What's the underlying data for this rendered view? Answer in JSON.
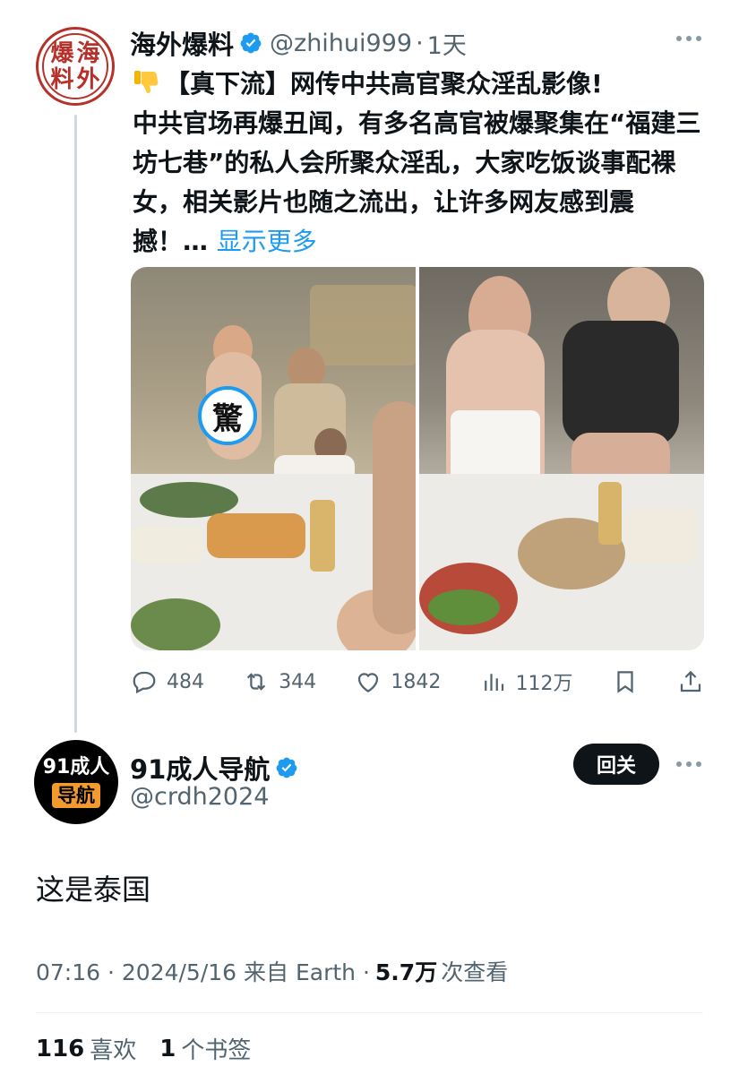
{
  "post1": {
    "avatar_chars": [
      "爆",
      "海",
      "料",
      "外"
    ],
    "name": "海外爆料",
    "handle": "@zhihui999",
    "separator": "·",
    "time": "1天",
    "line1": "【真下流】网传中共高官聚众淫乱影像!",
    "body": "中共官场再爆丑闻，有多名高官被爆聚集在“福建三坊七巷”的私人会所聚众淫乱，大家吃饭谈事配裸女，相关影片也随之流出，让许多网友感到震撼！…",
    "show_more": "显示更多",
    "censor_char": "驚",
    "actions": {
      "replies": "484",
      "reposts": "344",
      "likes": "1842",
      "views": "112万"
    }
  },
  "post2": {
    "avatar_top": "91成人",
    "avatar_bottom": "导航",
    "name": "91成人导航",
    "handle": "@crdh2024",
    "follow_label": "回关",
    "text": "这是泰国",
    "meta": {
      "time_date": "07:16 · 2024/5/16 来自 Earth ·",
      "views_count": "5.7万",
      "views_label": "次查看"
    },
    "stats": {
      "likes_count": "116",
      "likes_label": "喜欢",
      "bookmarks_count": "1",
      "bookmarks_label": "个书签"
    }
  },
  "colors": {
    "accent": "#1d9bf0",
    "text": "#0f1419",
    "secondary": "#536471",
    "seal_red": "#b5312a"
  }
}
